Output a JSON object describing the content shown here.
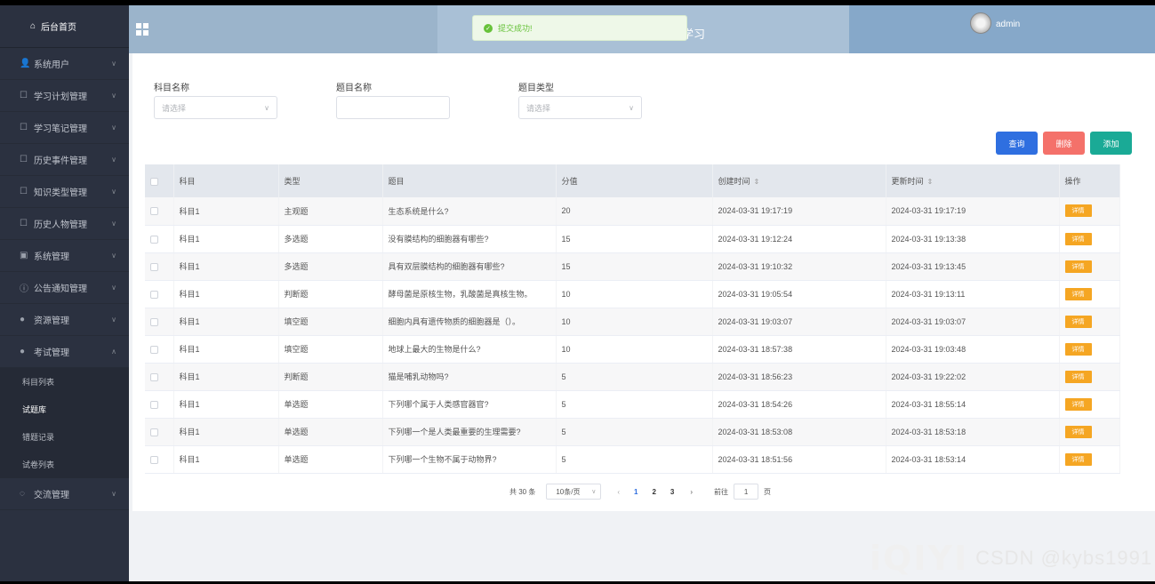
{
  "sidebar": {
    "home": "后台首页",
    "items": [
      {
        "label": "系统用户",
        "icon": "user-icon"
      },
      {
        "label": "学习计划管理",
        "icon": "edit-icon"
      },
      {
        "label": "学习笔记管理",
        "icon": "edit-icon"
      },
      {
        "label": "历史事件管理",
        "icon": "edit-icon"
      },
      {
        "label": "知识类型管理",
        "icon": "edit-icon"
      },
      {
        "label": "历史人物管理",
        "icon": "edit-icon"
      },
      {
        "label": "系统管理",
        "icon": "picture-icon"
      },
      {
        "label": "公告通知管理",
        "icon": "info-icon"
      },
      {
        "label": "资源管理",
        "icon": "location-icon"
      },
      {
        "label": "考试管理",
        "icon": "location-icon"
      }
    ],
    "exam_subitems": [
      "科目列表",
      "试题库",
      "错题记录",
      "试卷列表"
    ],
    "after_item": {
      "label": "交流管理",
      "icon": "chat-icon"
    }
  },
  "header": {
    "title_fragment": "学习",
    "user": "admin"
  },
  "toast": {
    "message": "提交成功!"
  },
  "filters": {
    "subject_label": "科目名称",
    "subject_placeholder": "请选择",
    "question_label": "题目名称",
    "question_value": "",
    "type_label": "题目类型",
    "type_placeholder": "请选择"
  },
  "actions": {
    "query": "查询",
    "delete": "删除",
    "add": "添加"
  },
  "table": {
    "headers": [
      "科目",
      "类型",
      "题目",
      "分值",
      "创建时间",
      "更新时间",
      "操作"
    ],
    "detail_label": "详情",
    "rows": [
      {
        "subject": "科目1",
        "type": "主观题",
        "question": "生态系统是什么?",
        "score": "20",
        "created": "2024-03-31 19:17:19",
        "updated": "2024-03-31 19:17:19"
      },
      {
        "subject": "科目1",
        "type": "多选题",
        "question": "没有膜结构的细胞器有哪些?",
        "score": "15",
        "created": "2024-03-31 19:12:24",
        "updated": "2024-03-31 19:13:38"
      },
      {
        "subject": "科目1",
        "type": "多选题",
        "question": "具有双层膜结构的细胞器有哪些?",
        "score": "15",
        "created": "2024-03-31 19:10:32",
        "updated": "2024-03-31 19:13:45"
      },
      {
        "subject": "科目1",
        "type": "判断题",
        "question": "酵母菌是原核生物，乳酸菌是真核生物。",
        "score": "10",
        "created": "2024-03-31 19:05:54",
        "updated": "2024-03-31 19:13:11"
      },
      {
        "subject": "科目1",
        "type": "填空题",
        "question": "细胞内具有遗传物质的细胞器是（）。",
        "score": "10",
        "created": "2024-03-31 19:03:07",
        "updated": "2024-03-31 19:03:07"
      },
      {
        "subject": "科目1",
        "type": "填空题",
        "question": "地球上最大的生物是什么?",
        "score": "10",
        "created": "2024-03-31 18:57:38",
        "updated": "2024-03-31 19:03:48"
      },
      {
        "subject": "科目1",
        "type": "判断题",
        "question": "猫是哺乳动物吗?",
        "score": "5",
        "created": "2024-03-31 18:56:23",
        "updated": "2024-03-31 19:22:02"
      },
      {
        "subject": "科目1",
        "type": "单选题",
        "question": "下列哪个属于人类感官器官?",
        "score": "5",
        "created": "2024-03-31 18:54:26",
        "updated": "2024-03-31 18:55:14"
      },
      {
        "subject": "科目1",
        "type": "单选题",
        "question": "下列哪一个是人类最重要的生理需要?",
        "score": "5",
        "created": "2024-03-31 18:53:08",
        "updated": "2024-03-31 18:53:18"
      },
      {
        "subject": "科目1",
        "type": "单选题",
        "question": "下列哪一个生物不属于动物界?",
        "score": "5",
        "created": "2024-03-31 18:51:56",
        "updated": "2024-03-31 18:53:14"
      }
    ]
  },
  "pagination": {
    "total": "共 30 条",
    "page_size": "10条/页",
    "pages": [
      "1",
      "2",
      "3"
    ],
    "current": "1",
    "goto_label": "前往",
    "goto_value": "1",
    "goto_suffix": "页"
  },
  "watermark": {
    "logo": "iQIYI",
    "text": "CSDN @kybs1991"
  },
  "colors": {
    "sidebar_bg": "#2b3140",
    "header_bg": "#9bb4cb",
    "query": "#2f6fe0",
    "delete": "#f4716a",
    "add": "#1aaa96",
    "detail": "#f5a623",
    "toast_green": "#67c23a"
  }
}
